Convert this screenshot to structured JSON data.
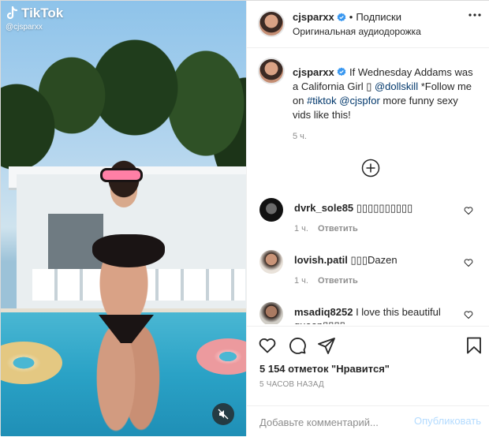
{
  "media": {
    "tiktok_name": "TikTok",
    "tiktok_handle": "@cjsparxx",
    "icons": {
      "logo": "tiktok-logo-icon",
      "mute": "speaker-muted-icon"
    }
  },
  "header": {
    "username": "cjsparxx",
    "separator": "•",
    "follow_label": "Подписки",
    "audio_label": "Оригинальная аудиодорожка"
  },
  "caption": {
    "username": "cjsparxx",
    "text_1": "If Wednesday Addams was a California Girl ",
    "emoji": "▯",
    "mention_1": "@dollskill",
    "text_2": " *Follow me on ",
    "hashtag": "#tiktok",
    "mention_2": "@cjspfor",
    "text_3": " more funny sexy vids like this!",
    "time": "5 ч."
  },
  "comments": [
    {
      "username": "dvrk_sole85",
      "text": "▯▯▯▯▯▯▯▯▯▯",
      "time": "1 ч.",
      "reply": "Ответить"
    },
    {
      "username": "lovish.patil",
      "text": "▯▯▯Dazen",
      "time": "1 ч.",
      "reply": "Ответить"
    },
    {
      "username": "msadiq8252",
      "text": "I love this beautiful queen▯▯▯▯"
    }
  ],
  "actions": {
    "likes": "5 154 отметок \"Нравится\"",
    "time_ago": "5 ЧАСОВ НАЗАД",
    "comment_placeholder": "Добавьте комментарий...",
    "post_label": "Опубликовать"
  },
  "colors": {
    "link": "#00376b",
    "verified": "#3897f0",
    "post_disabled": "#b3dbff",
    "muted_text": "#8e8e8e"
  }
}
